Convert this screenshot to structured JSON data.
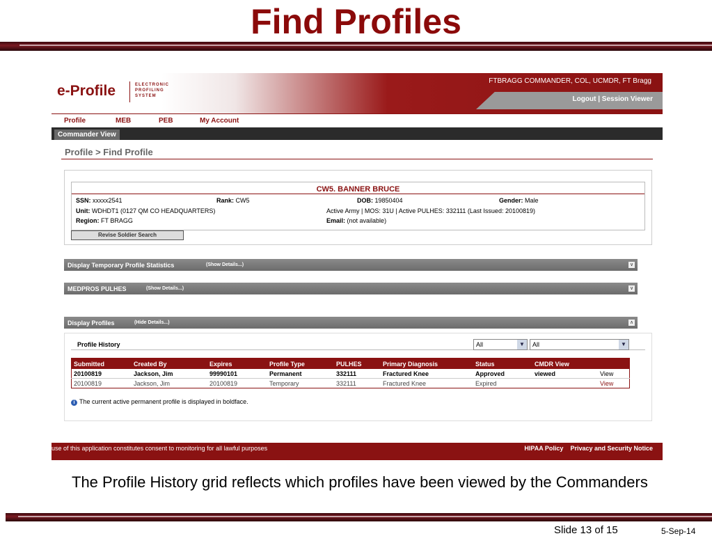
{
  "slide": {
    "title": "Find Profiles",
    "caption": "The Profile History grid reflects which profiles have been viewed by the Commanders",
    "slide_number": "Slide 13 of 15",
    "date": "5-Sep-14"
  },
  "header": {
    "logo": "e-Profile",
    "logo_subtitle_1": "ELECTRONIC",
    "logo_subtitle_2": "PROFILING",
    "logo_subtitle_3": "SYSTEM",
    "user": "FTBRAGG COMMANDER, COL, UCMDR, FT Bragg",
    "logout": "Logout",
    "separator": "|",
    "session_viewer": "Session Viewer"
  },
  "nav": {
    "items": [
      "Profile",
      "MEB",
      "PEB",
      "My Account"
    ],
    "subnav_tab": "Commander View"
  },
  "breadcrumb": "Profile > Find Profile",
  "soldier": {
    "name": "CW5. BANNER BRUCE",
    "ssn_label": "SSN:",
    "ssn": "xxxxx2541",
    "rank_label": "Rank:",
    "rank": "CW5",
    "dob_label": "DOB:",
    "dob": "19850404",
    "gender_label": "Gender:",
    "gender": "Male",
    "unit_label": "Unit:",
    "unit": "WDHDT1 (0127 QM CO HEADQUARTERS)",
    "status": "Active Army | MOS: 31U | Active PULHES: 332111 (Last Issued: 20100819)",
    "region_label": "Region:",
    "region": "FT BRAGG",
    "email_label": "Email:",
    "email": "(not available)",
    "revise_button": "Revise Soldier Search"
  },
  "sections": {
    "temp_stats": {
      "title": "Display Temporary Profile Statistics",
      "toggle": "(Show Details...)"
    },
    "pulhes": {
      "title": "MEDPROS PULHES",
      "toggle": "(Show Details...)"
    },
    "profiles": {
      "title": "Display Profiles",
      "toggle": "(Hide Details...)"
    }
  },
  "profile_history": {
    "title": "Profile History",
    "filter1": "All",
    "filter2": "All",
    "columns": [
      "Submitted",
      "Created By",
      "Expires",
      "Profile Type",
      "PULHES",
      "Primary Diagnosis",
      "Status",
      "CMDR View",
      ""
    ],
    "rows": [
      [
        "20100819",
        "Jackson, Jim",
        "99990101",
        "Permanent",
        "332111",
        "Fractured Knee",
        "Approved",
        "viewed",
        "View"
      ],
      [
        "20100819",
        "Jackson, Jim",
        "20100819",
        "Temporary",
        "332111",
        "Fractured Knee",
        "Expired",
        "",
        "View"
      ]
    ],
    "note": "The current active permanent profile is displayed in boldface."
  },
  "footer": {
    "consent": "use of this application constitutes consent to monitoring for all lawful purposes",
    "hipaa": "HIPAA Policy",
    "privacy": "Privacy and Security Notice"
  }
}
